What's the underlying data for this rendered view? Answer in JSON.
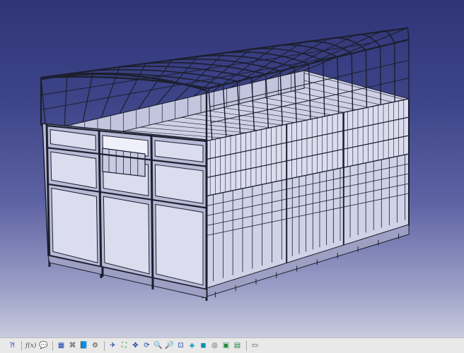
{
  "app": {
    "title": ""
  },
  "viewport": {
    "background_top": "#2f3577",
    "background_bottom": "#c9cbe0"
  },
  "model": {
    "subject": "flatbed cargo truck body with side rails and canopy frame",
    "line_color": "#1c1f2e",
    "panel_color": "#dcdcef",
    "frame_color": "#b8bbd6"
  },
  "toolbar": {
    "items": [
      {
        "name": "whats-this-help-button",
        "icon": "help-question-icon",
        "glyph": "⁈",
        "color": "blue"
      },
      {
        "sep": true
      },
      {
        "name": "formula-button",
        "icon": "formula-icon",
        "label": "f(x)",
        "color": "gray"
      },
      {
        "name": "comment-button",
        "icon": "speech-bubble-icon",
        "glyph": "💬",
        "color": "gray"
      },
      {
        "sep": true
      },
      {
        "name": "table-button",
        "icon": "table-icon",
        "glyph": "▦",
        "color": "blue"
      },
      {
        "name": "tree-expand-button",
        "icon": "tree-icon",
        "glyph": "⌘",
        "color": "gray"
      },
      {
        "name": "catalog-button",
        "icon": "book-icon",
        "glyph": "📘",
        "color": "blue"
      },
      {
        "name": "knowledge-button",
        "icon": "bulb-icon",
        "glyph": "⚙",
        "color": "gray"
      },
      {
        "sep": true
      },
      {
        "name": "fly-mode-button",
        "icon": "fly-icon",
        "glyph": "✈",
        "color": "blue"
      },
      {
        "name": "fit-all-button",
        "icon": "fit-all-icon",
        "glyph": "⛶",
        "color": "green"
      },
      {
        "name": "pan-button",
        "icon": "pan-icon",
        "glyph": "✥",
        "color": "blue"
      },
      {
        "name": "rotate-button",
        "icon": "rotate-icon",
        "glyph": "⟳",
        "color": "blue"
      },
      {
        "name": "zoom-in-button",
        "icon": "zoom-in-icon",
        "glyph": "🔍",
        "color": "blue"
      },
      {
        "name": "zoom-out-button",
        "icon": "zoom-out-icon",
        "glyph": "🔎",
        "color": "blue"
      },
      {
        "name": "normal-view-button",
        "icon": "normal-view-icon",
        "glyph": "⊡",
        "color": "blue"
      },
      {
        "name": "iso-view-button",
        "icon": "cube-view-icon",
        "glyph": "◈",
        "color": "cyan"
      },
      {
        "name": "shading-button",
        "icon": "shading-icon",
        "glyph": "◼",
        "color": "cyan"
      },
      {
        "name": "hide-show-button",
        "icon": "hide-show-icon",
        "glyph": "◎",
        "color": "gray"
      },
      {
        "name": "swap-visible-button",
        "icon": "swap-space-icon",
        "glyph": "▣",
        "color": "green"
      },
      {
        "name": "camera-button",
        "icon": "camera-icon",
        "glyph": "▤",
        "color": "green"
      },
      {
        "sep": true
      },
      {
        "name": "capture-button",
        "icon": "capture-icon",
        "glyph": "▭",
        "color": "gray"
      }
    ]
  }
}
